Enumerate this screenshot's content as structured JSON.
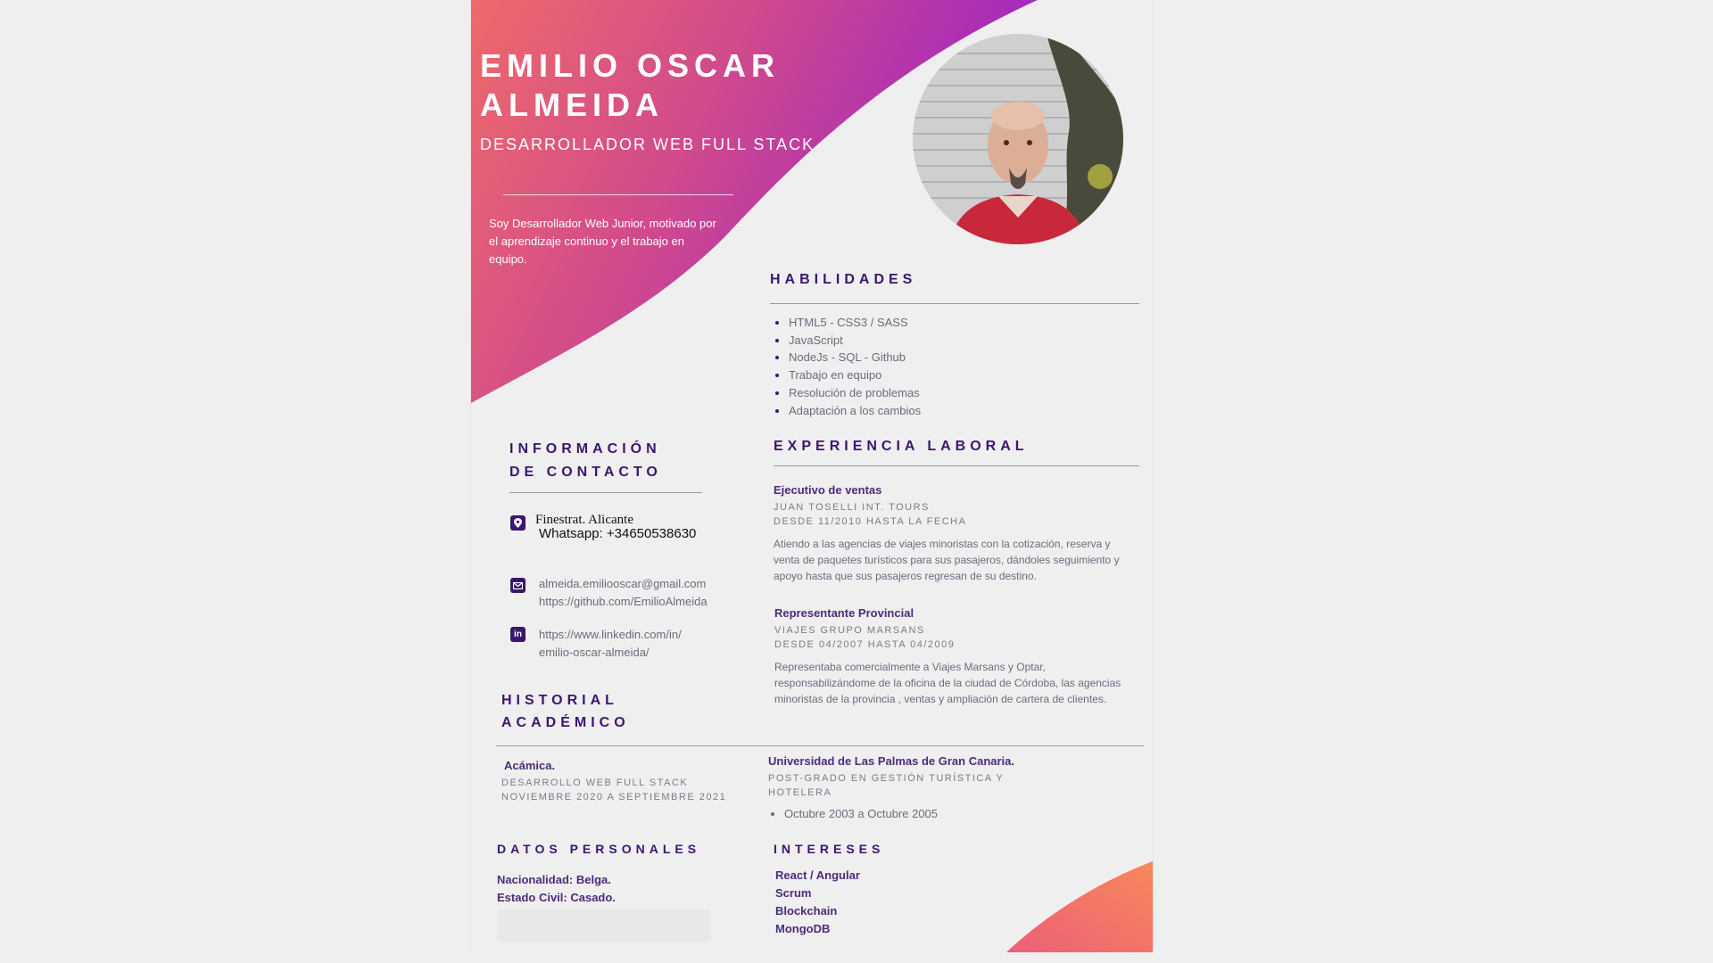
{
  "header": {
    "name_line1": "EMILIO OSCAR",
    "name_line2": "ALMEIDA",
    "role": "DESARROLLADOR WEB FULL STACK",
    "about": "Soy Desarrollador Web Junior, motivado por el aprendizaje continuo y el trabajo en equipo."
  },
  "skills": {
    "title": "HABILIDADES",
    "items": [
      "HTML5 - CSS3 / SASS",
      "JavaScript",
      "NodeJs - SQL - Github",
      "Trabajo en equipo",
      "Resolución de problemas",
      "Adaptación a los cambios"
    ]
  },
  "contact": {
    "title_line1": "INFORMACIÓN",
    "title_line2": "DE CONTACTO",
    "location": "Finestrat. Alicante",
    "whatsapp": "Whatsapp: +34650538630",
    "email": "almeida.emiliooscar@gmail.com",
    "github": "https://github.com/EmilioAlmeida",
    "linkedin_line1": "https://www.linkedin.com/in/",
    "linkedin_line2": "emilio-oscar-almeida/",
    "icons": [
      "location-icon",
      "mail-icon",
      "linkedin-icon"
    ]
  },
  "experience": {
    "title": "EXPERIENCIA LABORAL",
    "jobs": [
      {
        "title": "Ejecutivo de ventas",
        "company": "JUAN TOSELLI INT. TOURS",
        "dates": "DESDE 11/2010 HASTA LA FECHA",
        "description": " Atiendo a las agencias de viajes minoristas con la cotización, reserva y venta de paquetes turísticos para sus pasajeros, dándoles seguimiento y apoyo hasta que sus pasajeros regresan de su destino."
      },
      {
        "title": "Representante Provincial",
        "company": "VIAJES GRUPO MARSANS",
        "dates": "DESDE 04/2007 HASTA 04/2009",
        "description": "Representaba comercialmente a Viajes Marsans y Optar, responsabilizándome de la oficina de la ciudad de Córdoba, las agencias minoristas de la provincia , ventas y ampliación de cartera de clientes."
      }
    ]
  },
  "education": {
    "title_line1": "HISTORIAL",
    "title_line2": "ACADÉMICO",
    "left": {
      "school": "Acámica.",
      "program": "DESARROLLO WEB FULL STACK",
      "dates": "NOVIEMBRE 2020 A SEPTIEMBRE 2021"
    },
    "right": {
      "school": "Universidad de Las Palmas de Gran Canaria.",
      "program_line1": "POST-GRADO EN GESTIÓN TURÍSTICA Y",
      "program_line2": "HOTELERA",
      "dates": "Octubre 2003 a Octubre 2005"
    }
  },
  "personal": {
    "title": "DATOS PERSONALES",
    "nationality": "Nacionalidad: Belga.",
    "civil_status": "Estado Civil: Casado."
  },
  "interests": {
    "title": "INTERESES",
    "items": [
      "React / Angular",
      "Scrum",
      "Blockchain",
      "MongoDB"
    ]
  },
  "colors": {
    "accent": "#3b1670",
    "gradient_start": "#ee6a6a",
    "gradient_mid": "#d04a8c",
    "gradient_end": "#9b22c8",
    "corner_start": "#ec5f78",
    "corner_end": "#f7885a"
  }
}
